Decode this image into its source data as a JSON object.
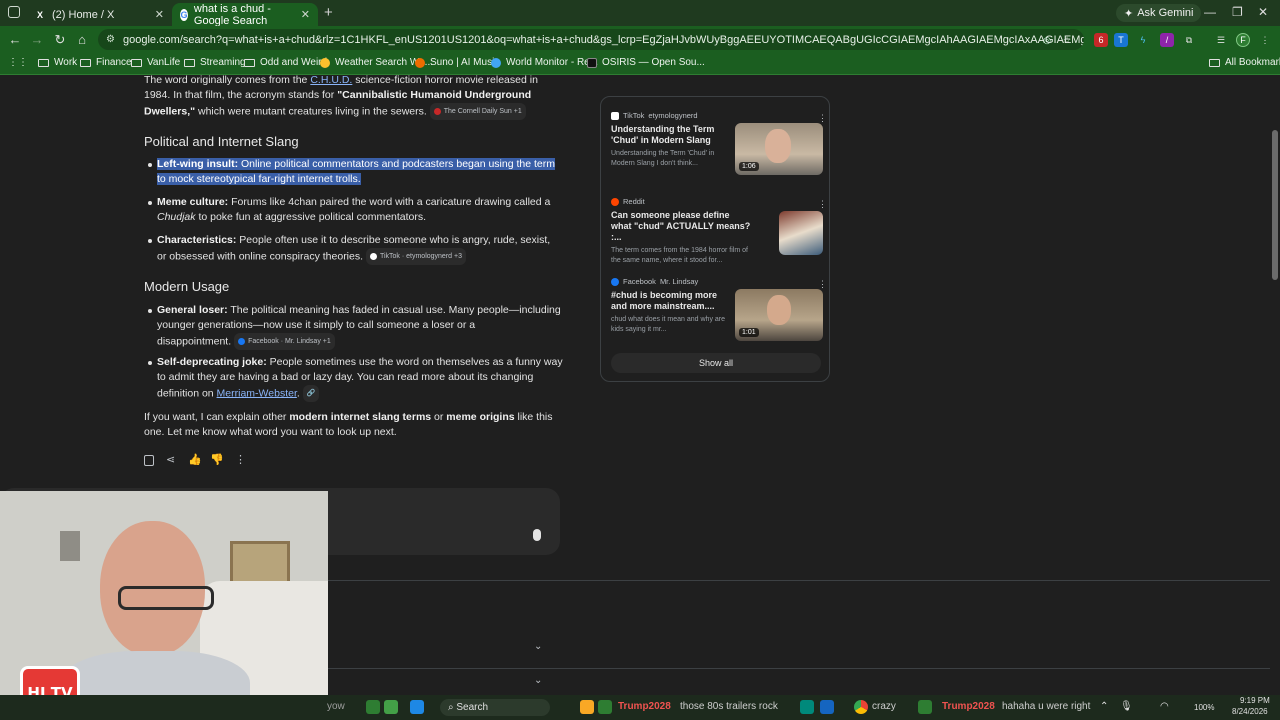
{
  "browser": {
    "tabs": [
      {
        "title": "(2) Home / X",
        "favicon": "X"
      },
      {
        "title": "what is a chud - Google Search",
        "favicon": "G"
      }
    ],
    "ask_gemini": "Ask Gemini",
    "url": "google.com/search?q=what+is+a+chud&rlz=1C1HKFL_enUS1201US1201&oq=what+is+a+chud&gs_lcrp=EgZjaHJvbWUyBggAEEUYOTIMCAEQABgUGIcCGIAEMgcIAhAAGIAEMgcIAxAAGIAEMgcIBBAAGIAEMgcIBRAAGIAEMgcIBhAAGIA...",
    "bookmarks": [
      {
        "label": "Work",
        "type": "folder"
      },
      {
        "label": "Finance",
        "type": "folder"
      },
      {
        "label": "VanLife",
        "type": "folder"
      },
      {
        "label": "Streaming",
        "type": "folder"
      },
      {
        "label": "Odd and Weird",
        "type": "folder"
      },
      {
        "label": "Weather Search We...",
        "type": "site"
      },
      {
        "label": "Suno | AI Music",
        "type": "site"
      },
      {
        "label": "World Monitor - Re...",
        "type": "site"
      },
      {
        "label": "OSIRIS — Open Sou...",
        "type": "site"
      }
    ],
    "all_bookmarks": "All Bookmarks",
    "profile_initial": "F"
  },
  "answer": {
    "intro_line1_pre": "The word originally comes from the ",
    "intro_link": "C.H.U.D.",
    "intro_line1_post": " science-fiction horror movie released in",
    "intro_line2_pre": "1984. In that film, the acronym stands for ",
    "intro_line2_bold": "\"Cannibalistic Humanoid Underground",
    "intro_line3_bold": "Dwellers,\"",
    "intro_line3_post": " which were mutant creatures living in the sewers.",
    "intro_chip": "The Cornell Daily Sun +1",
    "section1_heading": "Political and Internet Slang",
    "b1_label": "Left-wing insult:",
    "b1_text_l1": " Online political commentators and podcasters began using the term",
    "b1_text_l2": "to mock stereotypical far-right internet trolls.",
    "b2_label": "Meme culture:",
    "b2_text_l1": " Forums like 4chan paired the word with a caricature drawing called a",
    "b2_ital": "Chudjak",
    "b2_text_l2": " to poke fun at aggressive political commentators.",
    "b3_label": "Characteristics:",
    "b3_text_l1": " People often use it to describe someone who is angry, rude, sexist,",
    "b3_text_l2": "or obsessed with online conspiracy theories.",
    "b3_chip": "TikTok · etymologynerd +3",
    "section2_heading": "Modern Usage",
    "b4_label": "General loser:",
    "b4_text_l1": " The political meaning has faded in casual use. Many people—including",
    "b4_text_l2": "younger generations—now use it simply to call someone a loser or a",
    "b4_text_l3": "disappointment.",
    "b4_chip": "Facebook · Mr. Lindsay +1",
    "b5_label": "Self-deprecating joke:",
    "b5_text_l1": " People sometimes use the word on themselves as a funny way",
    "b5_text_l2": "to admit they are having a bad or lazy day. You can read more about its changing",
    "b5_text_l3_pre": "definition on ",
    "b5_link": "Merriam-Webster",
    "b5_text_l3_post": ".",
    "closing_l1_pre": "If you want, I can explain other ",
    "closing_bold1": "modern internet slang terms",
    "closing_mid": " or ",
    "closing_bold2": "meme origins",
    "closing_l1_post": " like this",
    "closing_l2": "one. Let me know what word you want to look up next."
  },
  "sources": [
    {
      "platform": "TikTok",
      "author": "etymologynerd",
      "title": "Understanding the Term 'Chud' in Modern Slang",
      "snippet": "Understanding the Term 'Chud' in Modern Slang I don't think...",
      "duration": "1:06"
    },
    {
      "platform": "Reddit",
      "author": "",
      "title": "Can someone please define what \"chud\" ACTUALLY means? :...",
      "snippet": "The term comes from the 1984 horror film of the same name, where it stood for...",
      "duration": ""
    },
    {
      "platform": "Facebook",
      "author": "Mr. Lindsay",
      "title": "#chud is becoming more and more mainstream....",
      "snippet": "chud what does it mean and why are kids saying it mr...",
      "duration": "1:01"
    }
  ],
  "show_all": "Show all",
  "taskbar": {
    "search": "Search",
    "ticker": [
      "yow",
      "Trump2028",
      "those 80s trailers rock",
      "crazy",
      "Trump2028",
      "hahaha u were right"
    ],
    "time": "9:19 PM",
    "date": "8/24/2026",
    "battery": "100%"
  },
  "overlay": {
    "logo_text": "HI TV"
  }
}
